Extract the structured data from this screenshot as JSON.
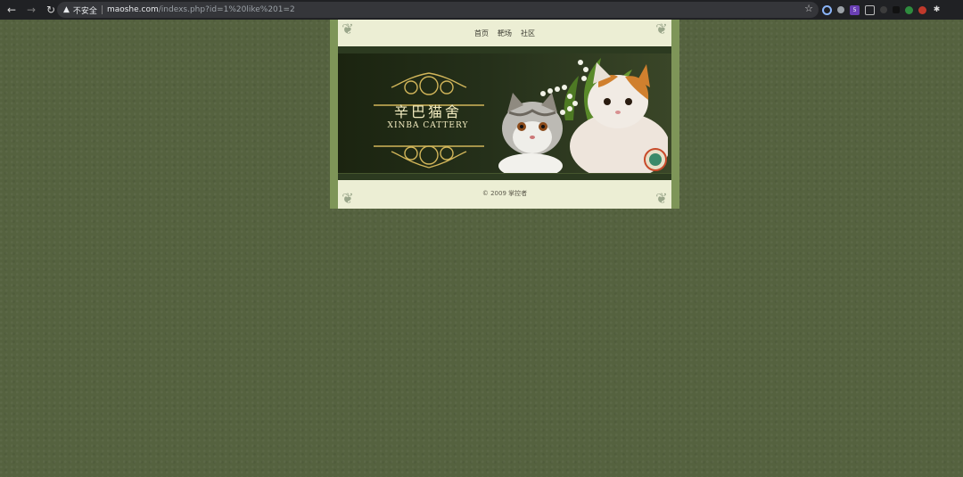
{
  "browser": {
    "security_label": "不安全",
    "url_domain": "maoshe.com",
    "url_path": "/indexs.php?id=1%20like%201=2",
    "extension_badge": "5"
  },
  "site": {
    "nav": [
      "首页",
      "靶场",
      "社区"
    ],
    "logo_title": "辛巴猫舍",
    "logo_subtitle": "XINBA CATTERY",
    "footer": "© 2009 掌控者"
  }
}
